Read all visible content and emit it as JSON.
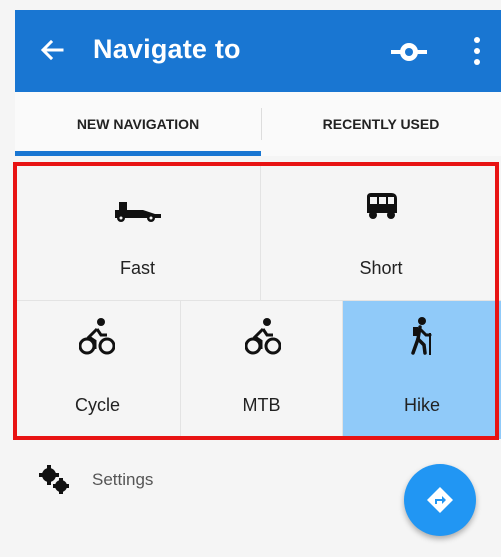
{
  "appbar": {
    "title": "Navigate to",
    "color": "#1976d2",
    "back_icon": "arrow-left-icon",
    "route_icon": "route-point-icon",
    "more_icon": "more-vert-icon"
  },
  "tabs": [
    {
      "label": "NEW NAVIGATION",
      "selected": true
    },
    {
      "label": "RECENTLY USED",
      "selected": false
    }
  ],
  "modes": [
    {
      "label": "Fast",
      "icon": "race-car-icon",
      "selected": false
    },
    {
      "label": "Short",
      "icon": "van-icon",
      "selected": false
    },
    {
      "label": "Cycle",
      "icon": "cyclist-icon",
      "selected": false
    },
    {
      "label": "MTB",
      "icon": "mountain-biker-icon",
      "selected": false
    },
    {
      "label": "Hike",
      "icon": "hiker-icon",
      "selected": true
    }
  ],
  "settings": {
    "label": "Settings",
    "icon": "gears-icon"
  },
  "fab": {
    "icon": "directions-icon",
    "color": "#2196f3"
  },
  "highlight_color": "#e81313",
  "selected_color": "#90caf9"
}
